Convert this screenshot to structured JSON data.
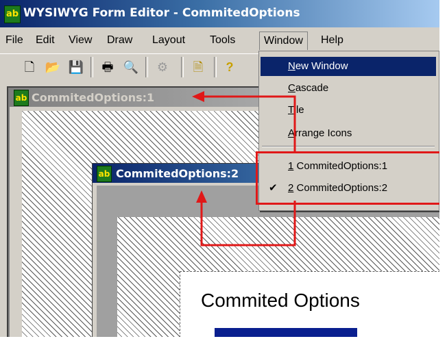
{
  "window": {
    "title": "WYSIWYG Form Editor - CommitedOptions",
    "icon_text": "ab"
  },
  "menubar": {
    "items": [
      "File",
      "Edit",
      "View",
      "Draw",
      "Layout",
      "Tools",
      "Window",
      "Help"
    ],
    "open_menu": "Window"
  },
  "toolbar": {
    "buttons": [
      "new-document-icon",
      "open-folder-icon",
      "save-icon",
      "print-icon",
      "print-preview-icon",
      "disabled-tool-icon",
      "form-icon",
      "help-icon"
    ]
  },
  "child_windows": [
    {
      "title": "CommitedOptions:1",
      "active": false
    },
    {
      "title": "CommitedOptions:2",
      "active": true
    }
  ],
  "form": {
    "label": "Commited Options"
  },
  "window_menu": {
    "items": [
      {
        "label": "New Window",
        "mnemonic_first": "N",
        "rest": "ew Window",
        "highlighted": true
      },
      {
        "label": "Cascade",
        "mnemonic_first": "C",
        "rest": "ascade"
      },
      {
        "label": "Tile",
        "mnemonic_first": "T",
        "rest": "ile"
      },
      {
        "label": "Arrange Icons",
        "mnemonic_first": "A",
        "rest": "rrange Icons"
      }
    ],
    "window_list": [
      {
        "num": "1",
        "label": "CommitedOptions:1",
        "checked": false
      },
      {
        "num": "2",
        "label": "CommitedOptions:2",
        "checked": true
      }
    ],
    "check_glyph": "✔"
  },
  "colors": {
    "menu_highlight": "#0a246a",
    "annotation_red": "#e01818",
    "face": "#d4d0c8"
  }
}
